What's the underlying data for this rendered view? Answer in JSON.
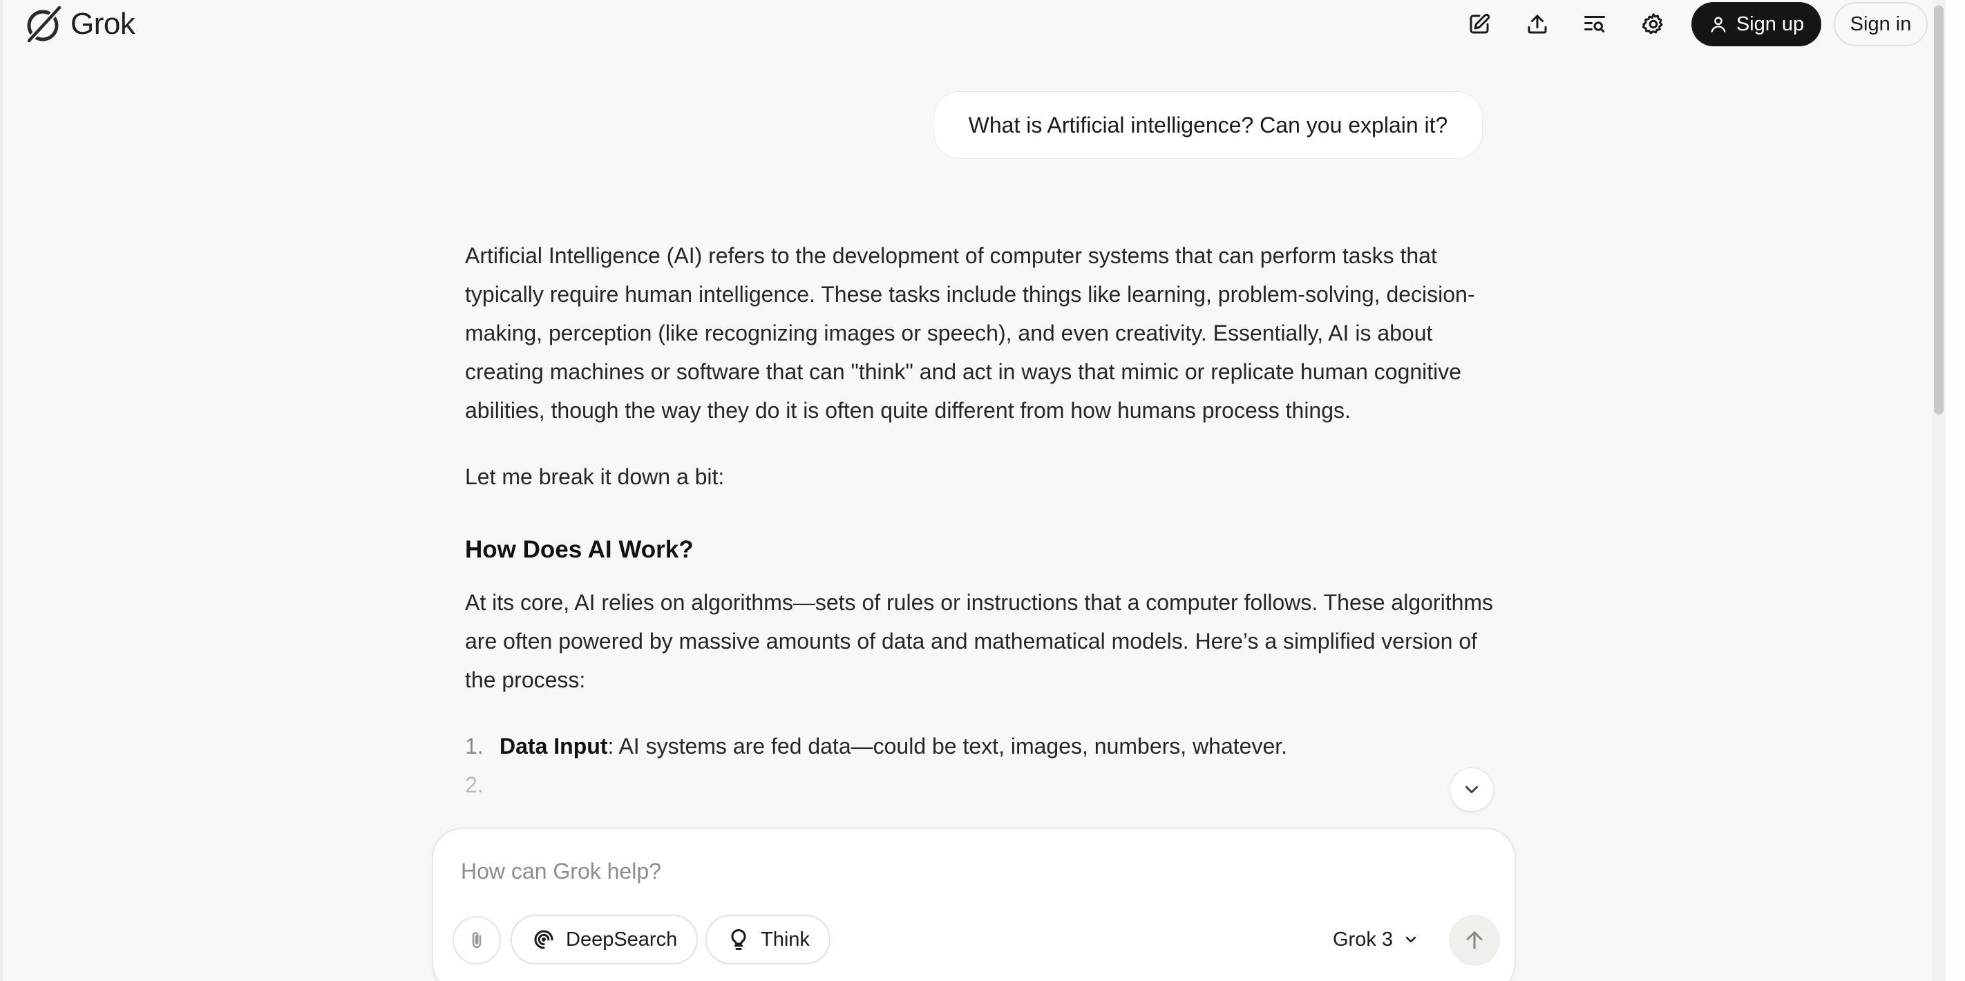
{
  "app": {
    "name": "Grok"
  },
  "header": {
    "icons": [
      "new-chat-icon",
      "share-icon",
      "search-history-icon",
      "settings-icon"
    ],
    "signup_label": "Sign up",
    "signin_label": "Sign in"
  },
  "conversation": {
    "user_message": "What is Artificial intelligence? Can you explain it?",
    "response": {
      "paragraph1": "Artificial Intelligence (AI) refers to the development of computer systems that can perform tasks that typically require human intelligence. These tasks include things like learning, problem-solving, decision-making, perception (like recognizing images or speech), and even creativity. Essentially, AI is about creating machines or software that can \"think\" and act in ways that mimic or replicate human cognitive abilities, though the way they do it is often quite different from how humans process things.",
      "paragraph2": "Let me break it down a bit:",
      "heading": "How Does AI Work?",
      "paragraph3": "At its core, AI relies on algorithms—sets of rules or instructions that a computer follows. These algorithms are often powered by massive amounts of data and mathematical models. Here’s a simplified version of the process:",
      "list": [
        {
          "number": "1.",
          "term": "Data Input",
          "text": ": AI systems are fed data—could be text, images, numbers, whatever."
        },
        {
          "number": "2.",
          "term": "",
          "text": ""
        }
      ]
    }
  },
  "composer": {
    "placeholder": "How can Grok help?",
    "deepsearch_label": "DeepSearch",
    "think_label": "Think",
    "model": "Grok 3"
  },
  "colors": {
    "background": "#f9f8f6",
    "primary_button": "#151515",
    "text": "#1a1a1a"
  }
}
